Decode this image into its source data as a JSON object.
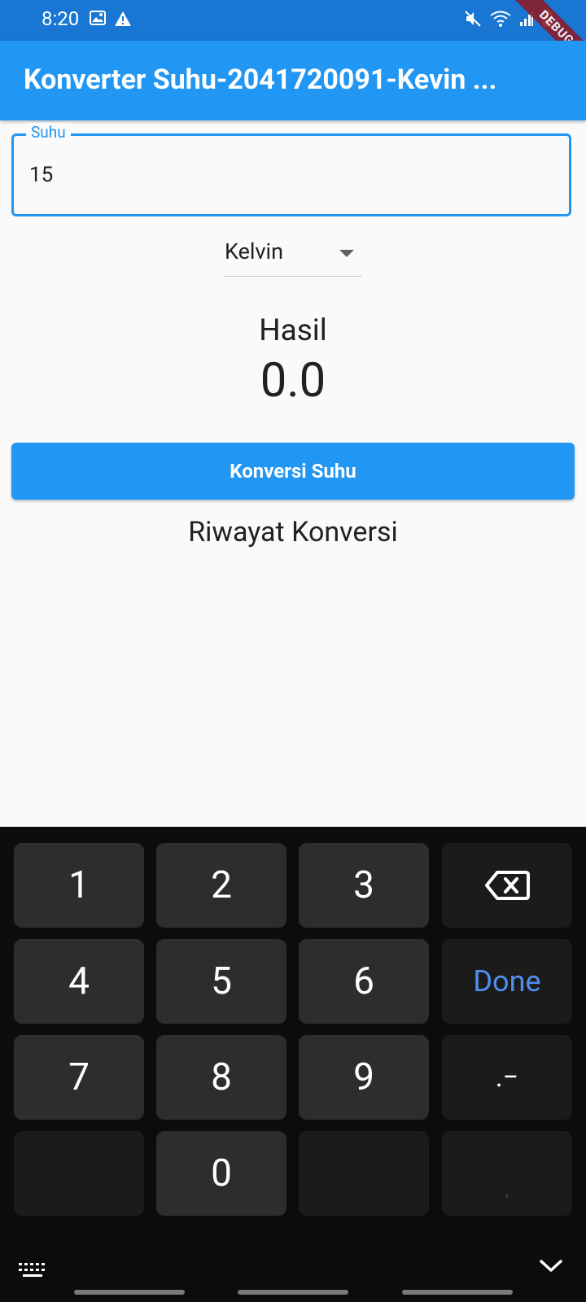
{
  "status_bar": {
    "time": "8:20",
    "icons_left": [
      "image-icon",
      "warning-icon"
    ],
    "icons_right": [
      "mute-icon",
      "wifi-icon",
      "signal-icon",
      "battery-charging-icon"
    ],
    "debug_banner": "DEBUG",
    "color": "#1976d2"
  },
  "app_bar": {
    "title": "Konverter Suhu-2041720091-Kevin ...",
    "color": "#2196f3"
  },
  "form": {
    "temperature_label": "Suhu",
    "temperature_value": "15",
    "unit_selected": "Kelvin"
  },
  "result": {
    "label": "Hasil",
    "value": "0.0"
  },
  "convert_button": {
    "label": "Konversi Suhu"
  },
  "history": {
    "title": "Riwayat Konversi"
  },
  "keyboard": {
    "keys": [
      {
        "label": "1",
        "style": "normal"
      },
      {
        "label": "2",
        "style": "normal"
      },
      {
        "label": "3",
        "style": "normal"
      },
      {
        "label": "",
        "style": "backspace",
        "icon": "backspace-icon"
      },
      {
        "label": "4",
        "style": "normal"
      },
      {
        "label": "5",
        "style": "normal"
      },
      {
        "label": "6",
        "style": "normal"
      },
      {
        "label": "Done",
        "style": "done"
      },
      {
        "label": "7",
        "style": "normal"
      },
      {
        "label": "8",
        "style": "normal"
      },
      {
        "label": "9",
        "style": "normal"
      },
      {
        "label": ".−",
        "style": "symbol"
      },
      {
        "label": "",
        "style": "blank"
      },
      {
        "label": "0",
        "style": "normal"
      },
      {
        "label": "",
        "style": "blank"
      },
      {
        "label": ",",
        "style": "blank"
      }
    ],
    "bottom_left_icon": "keyboard-switch-icon",
    "bottom_right_icon": "hide-keyboard-chevron-icon",
    "done_color": "#4f8ff0"
  }
}
